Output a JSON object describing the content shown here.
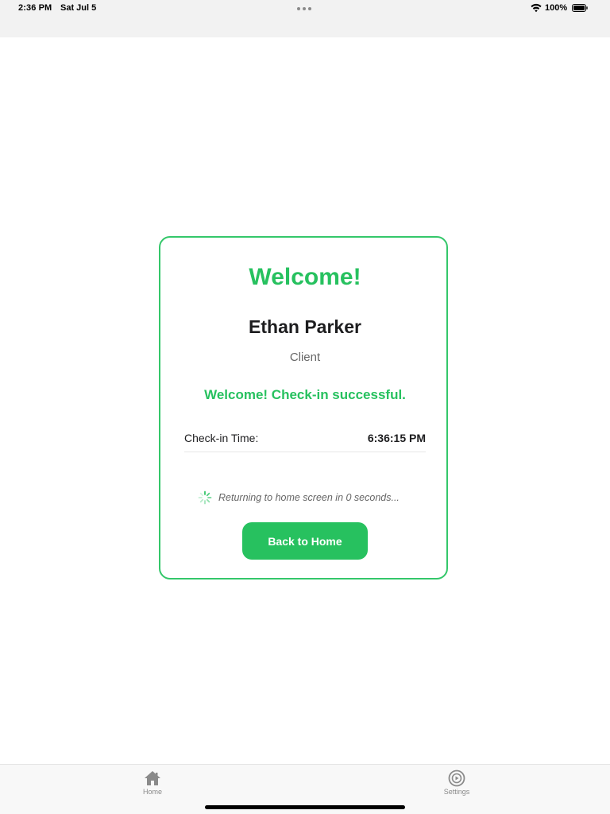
{
  "status_bar": {
    "time": "2:36 PM",
    "date": "Sat Jul 5",
    "battery": "100%"
  },
  "card": {
    "title": "Welcome!",
    "name": "Ethan Parker",
    "role": "Client",
    "success_message": "Welcome! Check-in successful.",
    "checkin_label": "Check-in Time:",
    "checkin_time": "6:36:15 PM",
    "returning_text": "Returning to home screen in 0 seconds...",
    "button_label": "Back to Home"
  },
  "tabs": [
    {
      "label": "Home",
      "icon": "house-icon"
    },
    {
      "label": "Settings",
      "icon": "settings-icon"
    }
  ],
  "colors": {
    "accent": "#27c15f",
    "border": "#34c76a"
  }
}
